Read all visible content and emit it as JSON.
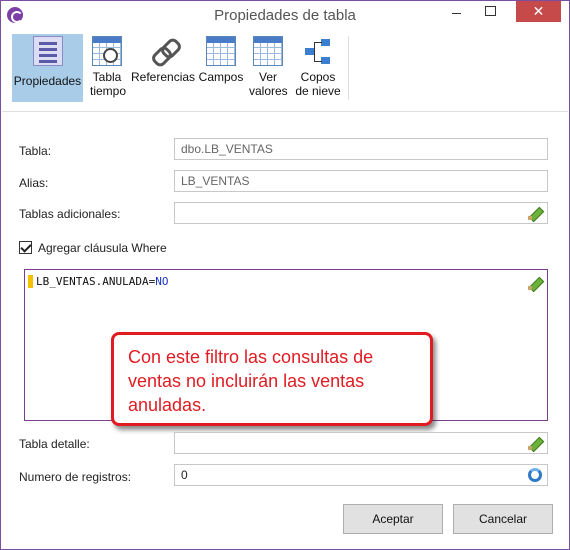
{
  "window": {
    "title": "Propiedades de tabla",
    "close_glyph": "✕"
  },
  "toolbar": {
    "items": [
      {
        "label": "Propiedades",
        "icon": "properties-icon",
        "active": true
      },
      {
        "label": "Tabla tiempo",
        "icon": "time-table-icon"
      },
      {
        "label": "Referencias",
        "icon": "references-icon"
      },
      {
        "label": "Campos",
        "icon": "fields-icon"
      },
      {
        "label": "Ver valores",
        "icon": "view-values-icon"
      },
      {
        "label": "Copos de nieve",
        "icon": "snowflake-icon"
      }
    ]
  },
  "form": {
    "tabla": {
      "label": "Tabla:",
      "value": "dbo.LB_VENTAS"
    },
    "alias": {
      "label": "Alias:",
      "value": "LB_VENTAS"
    },
    "tablas_adicionales": {
      "label": "Tablas adicionales:",
      "value": ""
    },
    "where": {
      "label": "Agregar cláusula Where",
      "checked": true,
      "code_field": "LB_VENTAS.ANULADA=",
      "code_keyword": "NO"
    },
    "tabla_detalle": {
      "label": "Tabla detalle:",
      "value": ""
    },
    "numero_registros": {
      "label": "Numero de registros:",
      "value": "0"
    }
  },
  "callout": {
    "text": "Con este filtro las consultas de ventas no incluirán las ventas anuladas."
  },
  "buttons": {
    "accept": "Aceptar",
    "cancel": "Cancelar"
  },
  "colors": {
    "accent": "#7b3fa6",
    "callout": "#e11b22",
    "active_tool": "#a9cce8",
    "close": "#c74a4a"
  }
}
